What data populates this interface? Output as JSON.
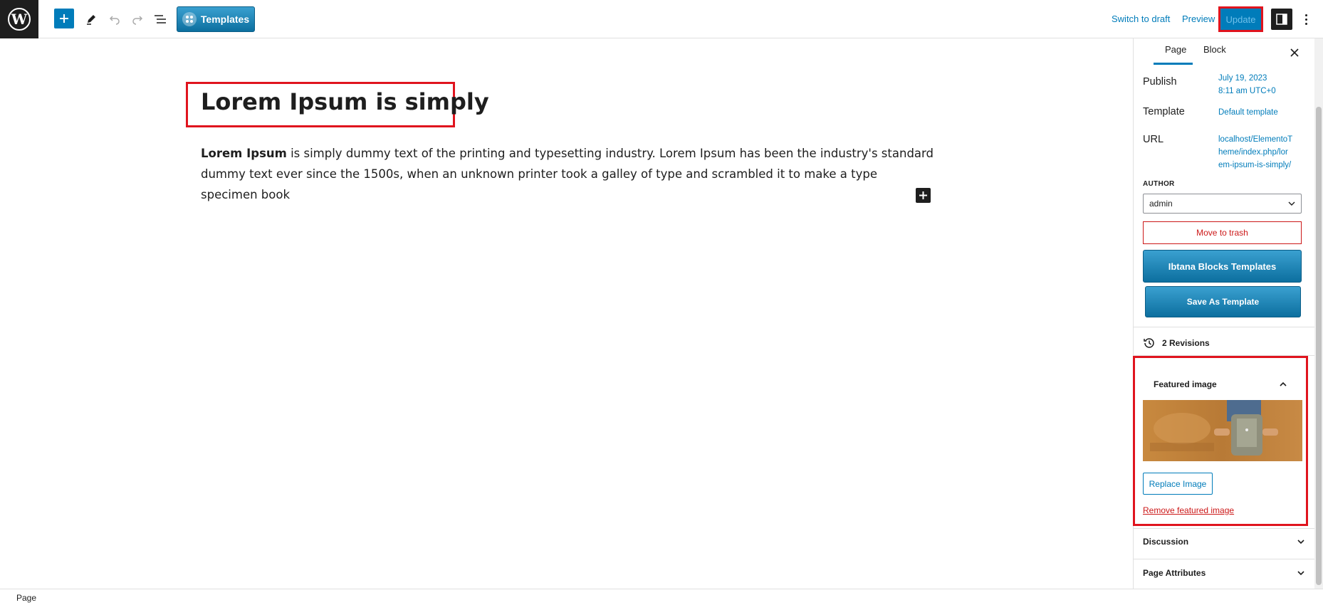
{
  "toolbar": {
    "templates_label": "Templates",
    "switch_to_draft": "Switch to draft",
    "preview": "Preview",
    "update": "Update"
  },
  "editor": {
    "title": "Lorem Ipsum is simply",
    "paragraph_bold": "Lorem Ipsum",
    "paragraph_rest": " is simply dummy text of the printing and typesetting industry. Lorem Ipsum has been the industry's standard dummy text ever since the 1500s, when an unknown printer took a galley of type and scrambled it to make a type specimen book"
  },
  "sidebar": {
    "tabs": [
      "Page",
      "Block"
    ],
    "publish_label": "Publish",
    "publish_value_line1": "July 19, 2023",
    "publish_value_line2": "8:11 am UTC+0",
    "template_label": "Template",
    "template_value": "Default template",
    "url_label": "URL",
    "url_value_line1": "localhost/ElementoT",
    "url_value_line2": "heme/index.php/lor",
    "url_value_line3": "em-ipsum-is-simply/",
    "author_label": "AUTHOR",
    "author_value": "admin",
    "move_to_trash": "Move to trash",
    "ibtana_templates": "Ibtana Blocks Templates",
    "save_as_template": "Save As Template",
    "revisions": "2 Revisions",
    "featured_image_title": "Featured image",
    "replace_image": "Replace Image",
    "remove_featured_image": "Remove featured image",
    "discussion": "Discussion",
    "page_attributes": "Page Attributes"
  },
  "footer": {
    "breadcrumb": "Page"
  },
  "colors": {
    "accent": "#007cba",
    "highlight": "#e0141e",
    "danger": "#cc1818"
  }
}
